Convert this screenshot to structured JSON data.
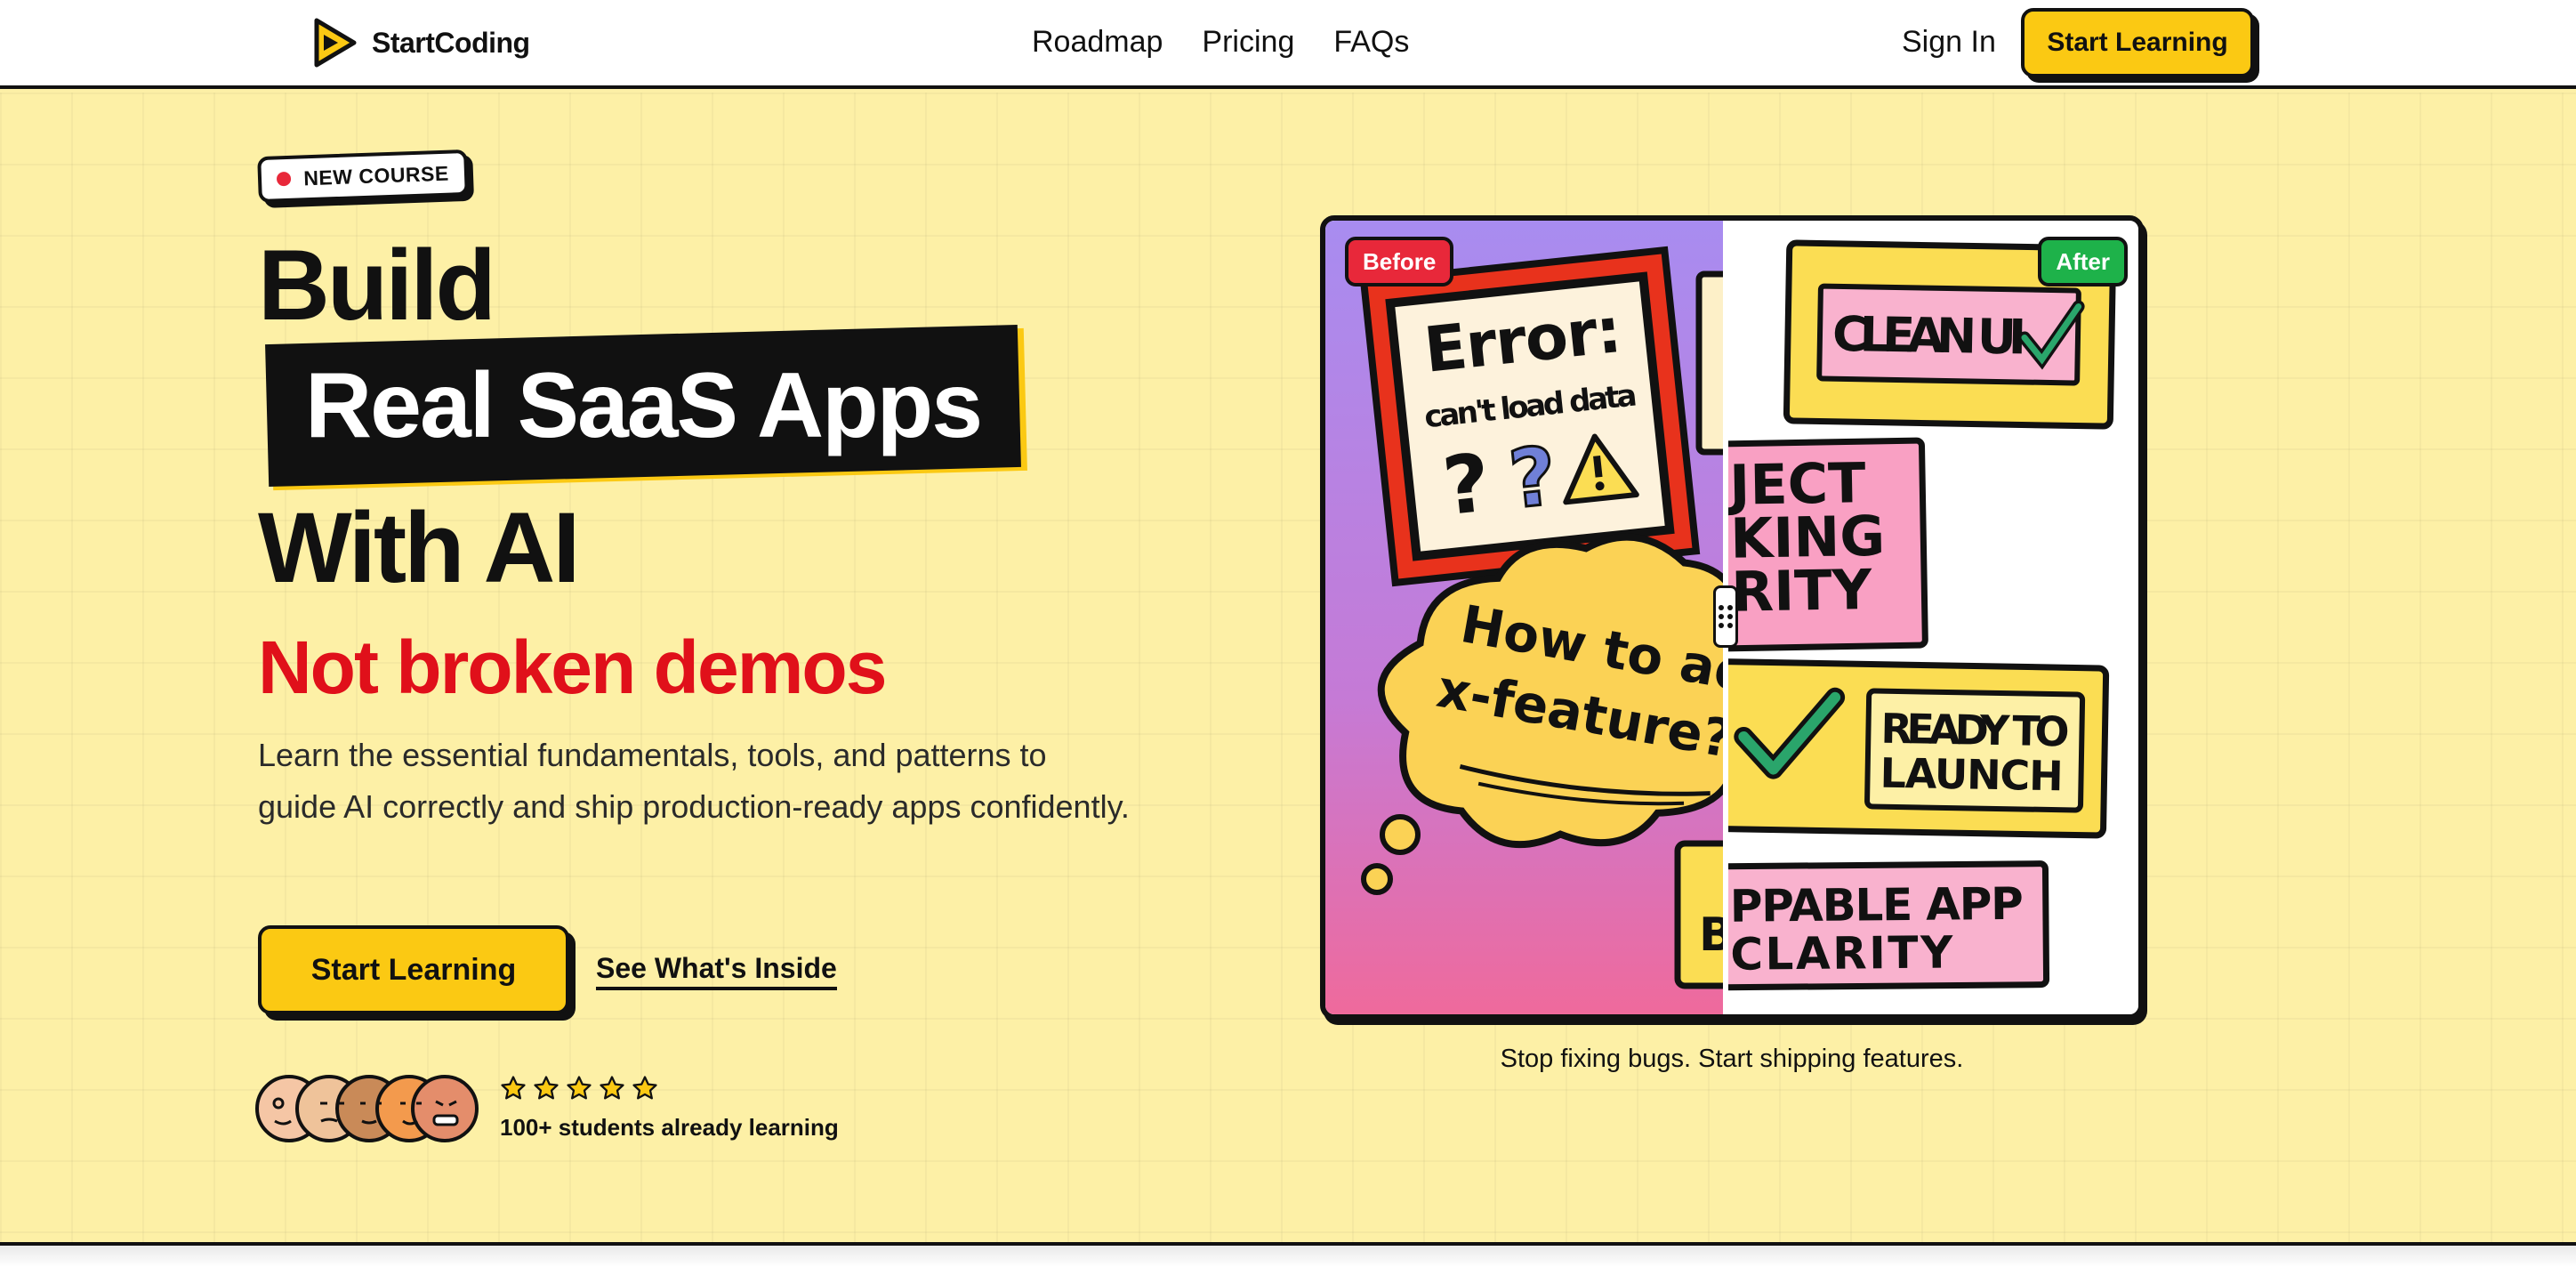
{
  "nav": {
    "brand": "StartCoding",
    "links": [
      "Roadmap",
      "Pricing",
      "FAQs"
    ],
    "sign_in": "Sign In",
    "cta": "Start Learning"
  },
  "hero": {
    "badge": "NEW COURSE",
    "headline_line1": "Build",
    "headline_highlight": "Real SaaS Apps",
    "headline_line3": "With AI",
    "subheadline": "Not broken demos",
    "description": "Learn the essential fundamentals, tools, and patterns to guide AI correctly and ship production-ready apps confidently.",
    "primary_cta": "Start Learning",
    "secondary_cta": "See What's Inside",
    "rating": 5,
    "students_text": "100+ students already learning"
  },
  "comparison": {
    "before_label": "Before",
    "after_label": "After",
    "before_art": {
      "error_title": "Error:",
      "error_sub": "can't load data",
      "cloud_line1": "How to add",
      "cloud_line2": "x-feature?"
    },
    "after_art": {
      "note1": "CLEAN UI",
      "note2_lines": [
        "JECT",
        "KING",
        "RITY"
      ],
      "note3_lines": [
        "READY TO",
        "LAUNCH"
      ],
      "note4_lines": [
        "PPABLE APP",
        "CLARITY"
      ]
    },
    "caption": "Stop fixing bugs. Start shipping features."
  },
  "colors": {
    "background": "#fdf0a6",
    "accent_yellow": "#fbc913",
    "accent_red": "#e0101a",
    "before_tag": "#e8283a",
    "after_tag": "#1eb24a"
  }
}
